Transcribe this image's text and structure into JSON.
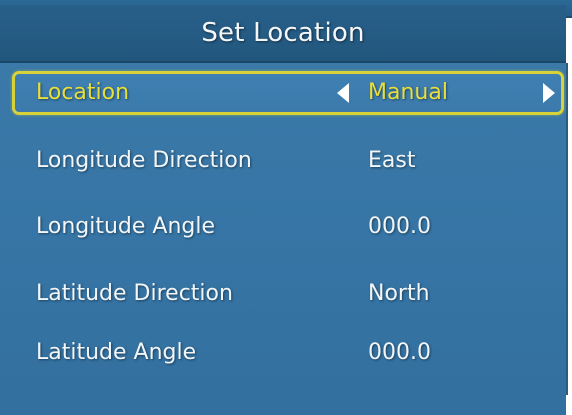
{
  "title": "Set Location",
  "colors": {
    "panel_blue": "#3675a5",
    "title_blue": "#255b83",
    "highlight_yellow": "#d8d23a",
    "text_white": "#f2f6f9"
  },
  "menu": {
    "location": {
      "label": "Location",
      "value": "Manual",
      "left_arrow_icon": "arrow-left-icon",
      "right_arrow_icon": "arrow-right-icon",
      "selected": true
    },
    "longitude_direction": {
      "label": "Longitude Direction",
      "value": "East"
    },
    "longitude_angle": {
      "label": "Longitude Angle",
      "value": "000.0"
    },
    "latitude_direction": {
      "label": "Latitude Direction",
      "value": "North"
    },
    "latitude_angle": {
      "label": "Latitude Angle",
      "value": "000.0"
    }
  }
}
